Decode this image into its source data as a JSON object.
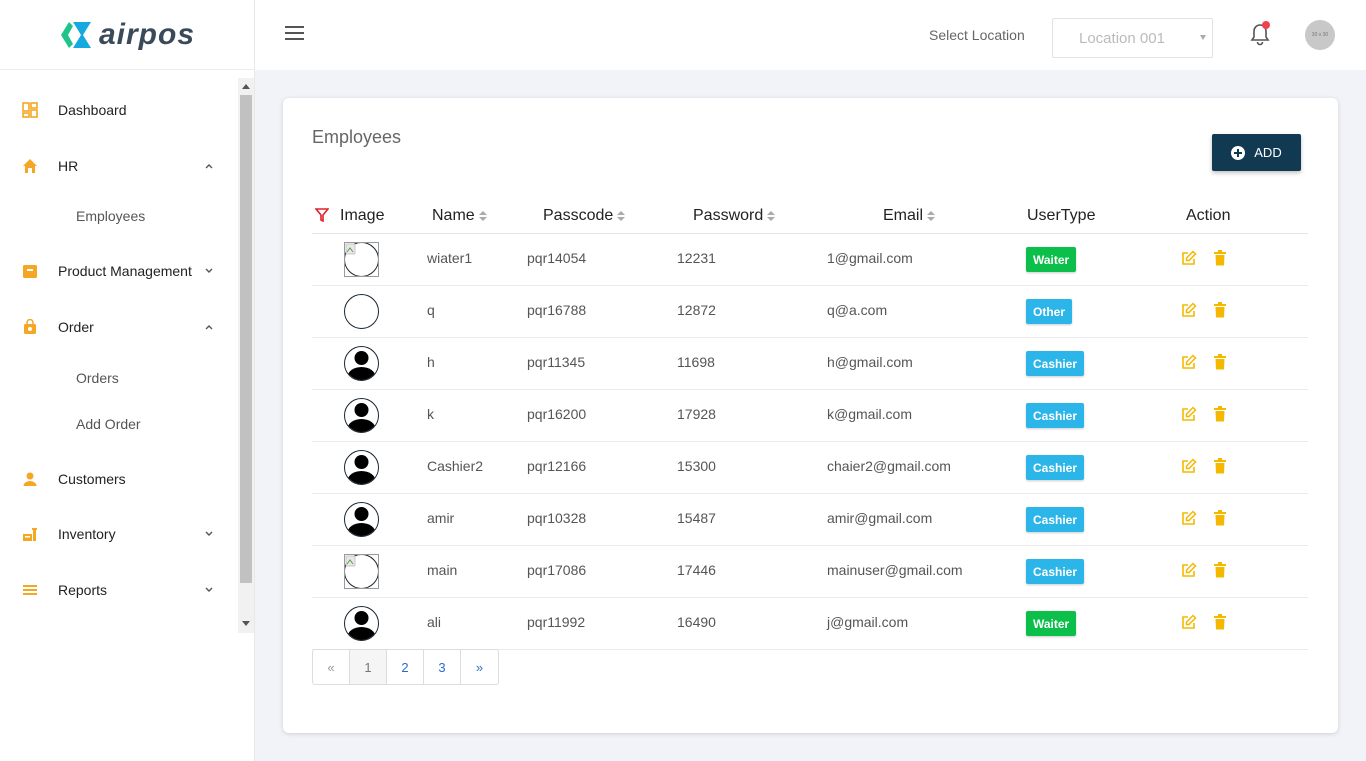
{
  "brand": {
    "name": "airpos"
  },
  "sidebar": {
    "items": [
      {
        "label": "Dashboard",
        "icon": "dashboard-icon"
      },
      {
        "label": "HR",
        "icon": "home-icon",
        "expanded": true,
        "children": [
          "Employees"
        ]
      },
      {
        "label": "Product Management",
        "icon": "box-icon",
        "expanded": false
      },
      {
        "label": "Order",
        "icon": "bag-icon",
        "expanded": true,
        "children": [
          "Orders",
          "Add Order"
        ]
      },
      {
        "label": "Customers",
        "icon": "user-icon"
      },
      {
        "label": "Inventory",
        "icon": "inventory-icon",
        "expanded": false
      },
      {
        "label": "Reports",
        "icon": "list-icon",
        "expanded": false
      }
    ],
    "accent": "#f5a623"
  },
  "header": {
    "select_location_label": "Select Location",
    "location_value": "Location 001",
    "avatar_text": "30 x 30"
  },
  "main": {
    "title": "Employees",
    "add_label": "ADD",
    "columns": [
      "Image",
      "Name",
      "Passcode",
      "Password",
      "Email",
      "UserType",
      "Action"
    ],
    "rows": [
      {
        "image": "broken",
        "name": "wiater1",
        "passcode": "pqr14054",
        "password": "12231",
        "email": "1@gmail.com",
        "usertype": "Waiter"
      },
      {
        "image": "empty",
        "name": "q",
        "passcode": "pqr16788",
        "password": "12872",
        "email": "q@a.com",
        "usertype": "Other"
      },
      {
        "image": "person",
        "name": "h",
        "passcode": "pqr11345",
        "password": "11698",
        "email": "h@gmail.com",
        "usertype": "Cashier"
      },
      {
        "image": "person",
        "name": "k",
        "passcode": "pqr16200",
        "password": "17928",
        "email": "k@gmail.com",
        "usertype": "Cashier"
      },
      {
        "image": "person",
        "name": "Cashier2",
        "passcode": "pqr12166",
        "password": "15300",
        "email": "chaier2@gmail.com",
        "usertype": "Cashier"
      },
      {
        "image": "person",
        "name": "amir",
        "passcode": "pqr10328",
        "password": "15487",
        "email": "amir@gmail.com",
        "usertype": "Cashier"
      },
      {
        "image": "broken",
        "name": "main",
        "passcode": "pqr17086",
        "password": "17446",
        "email": "mainuser@gmail.com",
        "usertype": "Cashier"
      },
      {
        "image": "person",
        "name": "ali",
        "passcode": "pqr11992",
        "password": "16490",
        "email": "j@gmail.com",
        "usertype": "Waiter"
      }
    ],
    "usertype_colors": {
      "Waiter": "#0bbf4a",
      "Other": "#2cb5e8",
      "Cashier": "#2cb5e8"
    },
    "pagination": {
      "prev": "«",
      "pages": [
        "1",
        "2",
        "3"
      ],
      "current": "1",
      "next": "»"
    }
  }
}
